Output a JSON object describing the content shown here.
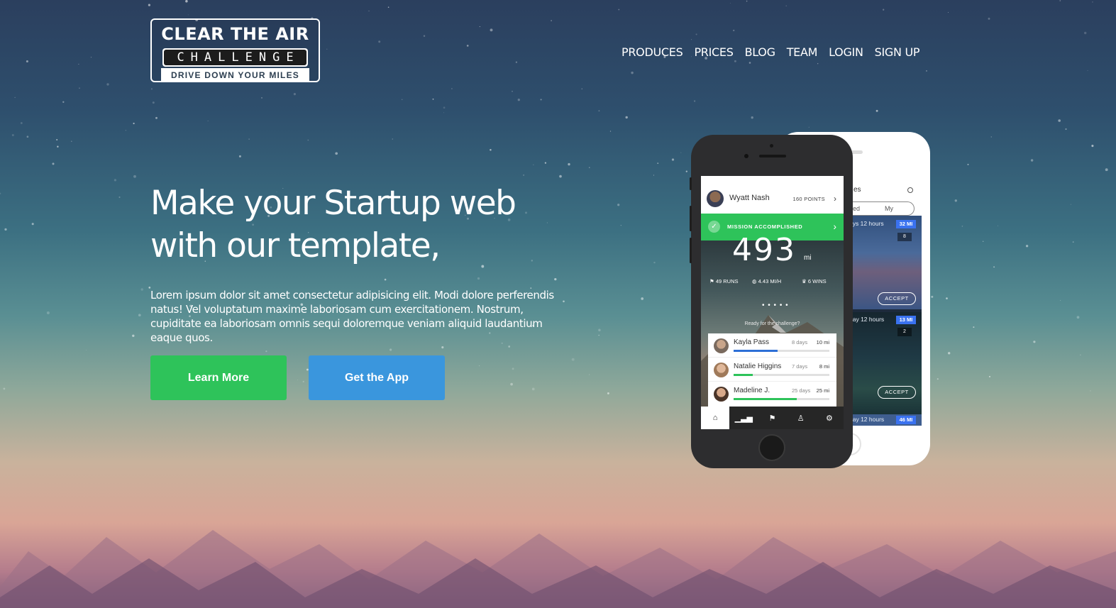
{
  "logo": {
    "line1": "CLEAR THE AIR",
    "line2": "CHALLENGE",
    "line3": "DRIVE DOWN YOUR MILES"
  },
  "nav": {
    "items": [
      "PRODUCES",
      "PRICES",
      "BLOG",
      "TEAM",
      "LOGIN",
      "SIGN UP"
    ]
  },
  "hero": {
    "title": "Make your Startup web with our template,",
    "text": "Lorem ipsum dolor sit amet consectetur adipisicing elit. Modi dolore perferendis natus! Vel voluptatum maxime laboriosam cum exercitationem. Nostrum, cupiditate ea laboriosam omnis sequi doloremque veniam aliquid laudantium eaque quos.",
    "learn_more": "Learn More",
    "get_app": "Get the App"
  },
  "colors": {
    "accent_green": "#2ec35a",
    "accent_blue": "#3a96dd"
  },
  "phone_front": {
    "user_name": "Wyatt Nash",
    "points": "160 POINTS",
    "mission": "MISSION ACCOMPLISHED",
    "big_number": "493",
    "unit": "mi",
    "stats": {
      "runs": "49 RUNS",
      "speed": "4.43 MI/H",
      "wins": "6 WINS"
    },
    "ready": "Ready for the challenge?",
    "leaders": [
      {
        "name": "Kayla Pass",
        "days": "8 days",
        "miles": "10 mi",
        "progress": 0.46,
        "color": "#2d6fd6"
      },
      {
        "name": "Natalie Higgins",
        "days": "7 days",
        "miles": "8 mi",
        "progress": 0.2,
        "color": "#2ec35a"
      },
      {
        "name": "Madeline J.",
        "days": "25 days",
        "miles": "25 mi",
        "progress": 0.66,
        "color": "#2ec35a"
      }
    ],
    "tabs": [
      "home-icon",
      "stats-icon",
      "flag-icon",
      "runner-icon",
      "gear-icon"
    ]
  },
  "phone_back": {
    "title_fragment": "es",
    "seg_left": "red",
    "seg_right": "My",
    "cards": [
      {
        "meta": "ays 12 hours",
        "badge": "32 MI",
        "count": "8",
        "accept": "ACCEPT"
      },
      {
        "meta": "day 12 hours",
        "badge": "13 MI",
        "count": "2",
        "accept": "ACCEPT"
      },
      {
        "meta": "day 12 hours",
        "badge": "46 MI"
      }
    ]
  }
}
